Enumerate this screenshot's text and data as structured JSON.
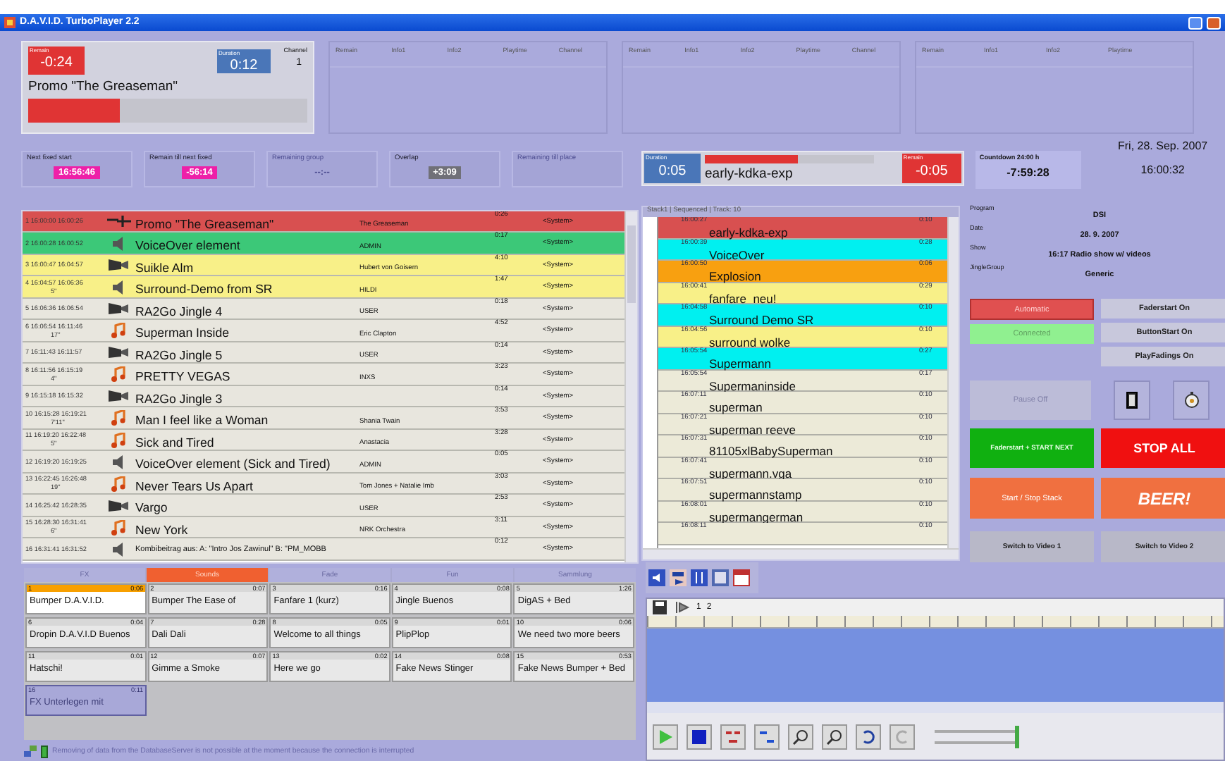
{
  "window": {
    "title": "D.A.V.I.D. TurboPlayer 2.2"
  },
  "decks": [
    {
      "kind": "active",
      "remain_label": "Remain",
      "remain": "-0:24",
      "duration_label": "Duration",
      "duration": "0:12",
      "channel_label": "Channel",
      "channel": "1",
      "title": "Promo \"The Greaseman\"",
      "level": 0.33
    },
    {
      "kind": "empty",
      "columns": [
        "Remain",
        "Info1",
        "Info2",
        "Playtime",
        "Channel"
      ]
    },
    {
      "kind": "empty",
      "columns": [
        "Remain",
        "Info1",
        "Info2",
        "Playtime",
        "Channel"
      ]
    },
    {
      "kind": "empty",
      "columns": [
        "Remain",
        "Info1",
        "Info2",
        "Playtime"
      ]
    }
  ],
  "info_boxes": [
    {
      "label": "Next fixed start",
      "value": "16:56:46",
      "kind": "alert",
      "disabled": false
    },
    {
      "label": "Remain till next fixed",
      "value": "-56:14",
      "kind": "alert",
      "disabled": false
    },
    {
      "label": "Remaining group",
      "value": "--:--",
      "kind": "plain",
      "disabled": true
    },
    {
      "label": "Overlap",
      "value": "+3:09",
      "kind": "badge",
      "disabled": false
    },
    {
      "label": "Remaining till place",
      "disabled": true
    }
  ],
  "playlist": {
    "rows": [
      {
        "num": "1",
        "start": "16:00:00",
        "end": "16:00:26",
        "title": "Promo \"The Greaseman\"",
        "artist": "The Greaseman",
        "duration": "0:26",
        "system": "<System>",
        "kind": "promo",
        "color": "#d85050"
      },
      {
        "num": "2",
        "start": "16:00:28",
        "end": "16:00:52",
        "title": "VoiceOver element",
        "artist": "ADMIN",
        "duration": "0:17",
        "system": "<System>",
        "kind": "voice",
        "color": "#3cc878"
      },
      {
        "num": "3",
        "start": "16:00:47",
        "end": "16:04:57",
        "title": "Suikle Alm",
        "artist": "Hubert von Goisern",
        "duration": "4:10",
        "system": "<System>",
        "kind": "video",
        "color": "#f8f088"
      },
      {
        "num": "4",
        "start": "16:04:57",
        "end": "16:06:36",
        "intro": "5\"",
        "title": "Surround-Demo from SR",
        "artist": "HILDI",
        "duration": "1:47",
        "system": "<System>",
        "kind": "voice",
        "color": "#f8f088"
      },
      {
        "num": "5",
        "start": "16:06:36",
        "end": "16:06:54",
        "title": "RA2Go Jingle 4",
        "artist": "USER",
        "duration": "0:18",
        "system": "<System>",
        "kind": "video",
        "color": "#e8e6de"
      },
      {
        "num": "6",
        "start": "16:06:54",
        "end": "16:11:46",
        "intro": "17\"",
        "title": "Superman Inside",
        "artist": "Eric Clapton",
        "duration": "4:52",
        "system": "<System>",
        "kind": "music",
        "color": "#e8e6de"
      },
      {
        "num": "7",
        "start": "16:11:43",
        "end": "16:11:57",
        "title": "RA2Go Jingle 5",
        "artist": "USER",
        "duration": "0:14",
        "system": "<System>",
        "kind": "video",
        "color": "#e8e6de"
      },
      {
        "num": "8",
        "start": "16:11:56",
        "end": "16:15:19",
        "intro": "4\"",
        "title": "PRETTY VEGAS",
        "artist": "INXS",
        "duration": "3:23",
        "system": "<System>",
        "kind": "music",
        "color": "#e8e6de"
      },
      {
        "num": "9",
        "start": "16:15:18",
        "end": "16:15:32",
        "title": "RA2Go Jingle 3",
        "duration": "0:14",
        "system": "<System>",
        "kind": "video",
        "color": "#e8e6de"
      },
      {
        "num": "10",
        "start": "16:15:28",
        "end": "16:19:21",
        "intro": "7'11\"",
        "title": "Man I feel like a Woman",
        "artist": "Shania Twain",
        "duration": "3:53",
        "system": "<System>",
        "kind": "music",
        "color": "#e8e6de"
      },
      {
        "num": "11",
        "start": "16:19:20",
        "end": "16:22:48",
        "intro": "5\"",
        "title": "Sick and Tired",
        "artist": "Anastacia",
        "duration": "3:28",
        "system": "<System>",
        "kind": "music",
        "color": "#e8e6de"
      },
      {
        "num": "12",
        "start": "16:19:20",
        "end": "16:19:25",
        "title": "VoiceOver element (Sick and Tired)",
        "artist": "ADMIN",
        "duration": "0:05",
        "system": "<System>",
        "kind": "voice",
        "color": "#e8e6de"
      },
      {
        "num": "13",
        "start": "16:22:45",
        "end": "16:26:48",
        "intro": "19\"",
        "title": "Never Tears Us Apart",
        "artist": "Tom Jones + Natalie Imb",
        "duration": "3:03",
        "system": "<System>",
        "kind": "music",
        "color": "#e8e6de"
      },
      {
        "num": "14",
        "start": "16:25:42",
        "end": "16:28:35",
        "title": "Vargo",
        "artist": "USER",
        "duration": "2:53",
        "system": "<System>",
        "kind": "video",
        "color": "#e8e6de"
      },
      {
        "num": "15",
        "start": "16:28:30",
        "end": "16:31:41",
        "intro": "6\"",
        "title": "New York",
        "artist": "NRK Orchestra",
        "duration": "3:11",
        "system": "<System>",
        "kind": "music",
        "color": "#e8e6de"
      },
      {
        "num": "16",
        "start": "16:31:41",
        "end": "16:31:52",
        "title": "Kombibeitrag aus:  A: \"Intro Jos Zawinul\"  B: \"PM_MOBB",
        "duration": "0:12",
        "system": "<System>",
        "kind": "voice",
        "color": "#e8e6de"
      }
    ]
  },
  "stack_player": {
    "duration_label": "Duration",
    "duration": "0:05",
    "title": "early-kdka-exp",
    "level": 0.55,
    "remain_label": "Remain",
    "remain": "-0:05"
  },
  "countdown": {
    "label": "Countdown 24:00 h",
    "value": "-7:59:28"
  },
  "clock": {
    "date": "Fri, 28. Sep. 2007",
    "time": "16:00:32"
  },
  "stack": {
    "header": "Stack1 | Sequenced | Track: 10",
    "rows": [
      {
        "time": "16:00:27",
        "title": "early-kdka-exp",
        "duration": "0:10",
        "color": "#d85050"
      },
      {
        "time": "16:00:39",
        "title": "VoiceOver",
        "duration": "0:28",
        "color": "#00f0f0"
      },
      {
        "time": "16:00:50",
        "title": "Explosion",
        "duration": "0:06",
        "color": "#f8a010"
      },
      {
        "time": "16:00:41",
        "title": "fanfare_neu!",
        "duration": "0:29",
        "color": "#f8f088"
      },
      {
        "time": "16:04:58",
        "title": "Surround Demo SR",
        "duration": "0:10",
        "color": "#00f0f0"
      },
      {
        "time": "16:04:56",
        "title": "surround wolke",
        "duration": "0:10",
        "color": "#f8f088"
      },
      {
        "time": "16:05:54",
        "title": "Supermann",
        "duration": "0:27",
        "color": "#00f0f0"
      },
      {
        "time": "16:05:54",
        "title": "Supermaninside",
        "duration": "0:17",
        "color": "#ecead8"
      },
      {
        "time": "16:07:11",
        "title": "superman",
        "duration": "0:10",
        "color": "#ecead8"
      },
      {
        "time": "16:07:21",
        "title": "superman reeve",
        "duration": "0:10",
        "color": "#ecead8"
      },
      {
        "time": "16:07:31",
        "title": "81105xlBabySuperman",
        "duration": "0:10",
        "color": "#ecead8"
      },
      {
        "time": "16:07:41",
        "title": "supermann.vga",
        "duration": "0:10",
        "color": "#ecead8"
      },
      {
        "time": "16:07:51",
        "title": "supermannstamp",
        "duration": "0:10",
        "color": "#ecead8"
      },
      {
        "time": "16:08:01",
        "title": "supermangerman",
        "duration": "0:10",
        "color": "#ecead8"
      },
      {
        "time": "16:08:11",
        "duration": "0:10",
        "color": "#ecead8"
      }
    ]
  },
  "info_fields": [
    {
      "label": "Program",
      "value": "DSI"
    },
    {
      "label": "Date",
      "value": "28. 9. 2007"
    },
    {
      "label": "Show",
      "value": "16:17 Radio show w/ videos"
    },
    {
      "label": "JingleGroup",
      "value": "Generic"
    }
  ],
  "mode_buttons": [
    {
      "label": "Automatic",
      "kind": "automatic"
    },
    {
      "label": "Connected",
      "kind": "connected"
    }
  ],
  "toggle_buttons": [
    "Faderstart On",
    "ButtonStart On",
    "PlayFadings On"
  ],
  "pause_button": "Pause Off",
  "icon_buttons": [
    {
      "kind": "cassette"
    },
    {
      "kind": "timer"
    }
  ],
  "action_buttons": [
    {
      "label": "Faderstart + START NEXT",
      "kind": "go"
    },
    {
      "label": "STOP ALL",
      "kind": "stop"
    },
    {
      "label": "Start / Stop Stack",
      "kind": "stack"
    },
    {
      "label": "BEER!",
      "kind": "beer"
    },
    {
      "label": "Switch to Video 1",
      "kind": "video"
    },
    {
      "label": "Switch to Video 2",
      "kind": "video"
    }
  ],
  "cart_tabs": [
    {
      "label": "FX",
      "selected": false
    },
    {
      "label": "Sounds",
      "selected": true
    },
    {
      "label": "Fade",
      "selected": false
    },
    {
      "label": "Fun",
      "selected": false
    },
    {
      "label": "Sammlung",
      "selected": false
    }
  ],
  "carts": [
    {
      "num": "1",
      "duration": "0:06",
      "title": "Bumper D.A.V.I.D.",
      "playing": true,
      "selected": false
    },
    {
      "num": "2",
      "duration": "0:07",
      "title": "Bumper The Ease of",
      "playing": false,
      "selected": false
    },
    {
      "num": "3",
      "duration": "0:16",
      "title": "Fanfare 1 (kurz)",
      "playing": false,
      "selected": false
    },
    {
      "num": "4",
      "duration": "0:08",
      "title": "Jingle Buenos",
      "playing": false,
      "selected": false
    },
    {
      "num": "5",
      "duration": "1:26",
      "title": "DigAS + Bed",
      "playing": false,
      "selected": false
    },
    {
      "num": "6",
      "duration": "0:04",
      "title": "Dropin D.A.V.I.D Buenos",
      "playing": false,
      "selected": false
    },
    {
      "num": "7",
      "duration": "0:28",
      "title": "Dali Dali",
      "playing": false,
      "selected": false
    },
    {
      "num": "8",
      "duration": "0:05",
      "title": "Welcome to all things",
      "playing": false,
      "selected": false
    },
    {
      "num": "9",
      "duration": "0:01",
      "title": "PlipPlop",
      "playing": false,
      "selected": false
    },
    {
      "num": "10",
      "duration": "0:06",
      "title": "We need two more beers",
      "playing": false,
      "selected": false
    },
    {
      "num": "11",
      "duration": "0:01",
      "title": "Hatschi!",
      "playing": false,
      "selected": false
    },
    {
      "num": "12",
      "duration": "0:07",
      "title": "Gimme a Smoke",
      "playing": false,
      "selected": false
    },
    {
      "num": "13",
      "duration": "0:02",
      "title": "Here we go",
      "playing": false,
      "selected": false
    },
    {
      "num": "14",
      "duration": "0:08",
      "title": "Fake News Stinger",
      "playing": false,
      "selected": false
    },
    {
      "num": "15",
      "duration": "0:53",
      "title": "Fake News Bumper + Bed",
      "playing": false,
      "selected": false
    },
    {
      "num": "16",
      "duration": "0:11",
      "title": "FX Unterlegen mit",
      "playing": false,
      "selected": true
    }
  ],
  "status_bar": {
    "message": "Removing of data from the DatabaseServer is not possible at the moment because the connection is interrupted"
  },
  "editor": {
    "tracks": [
      "1",
      "2"
    ],
    "sliders": [
      {
        "level": 1
      },
      {
        "level": 1
      }
    ]
  }
}
